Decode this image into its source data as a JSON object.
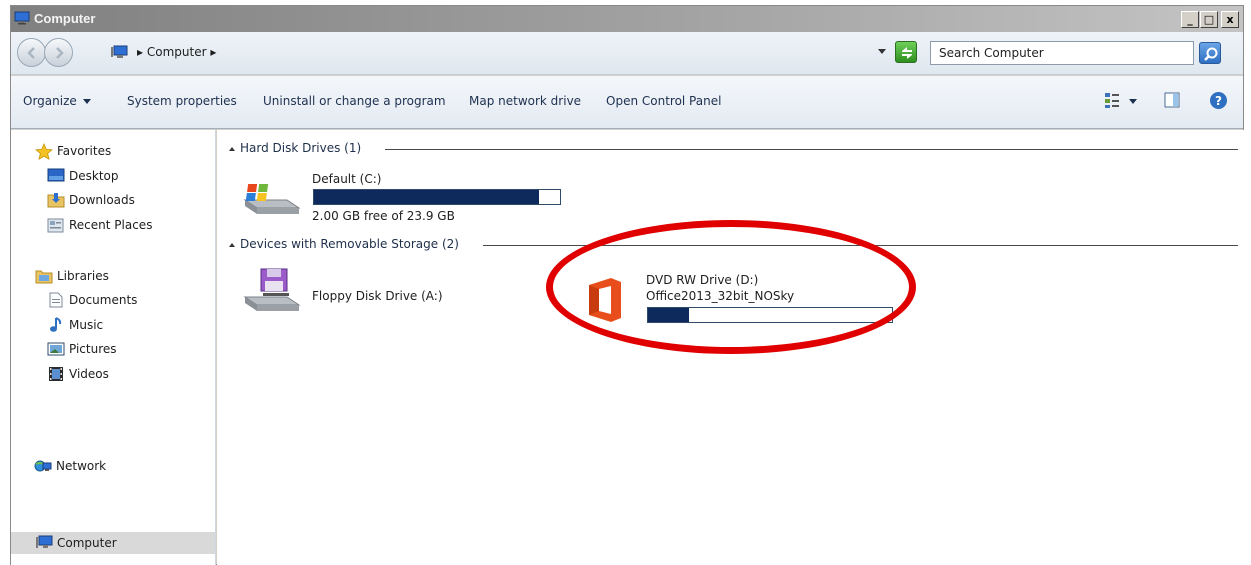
{
  "window": {
    "title": "Computer"
  },
  "caption": {
    "minimize": "_",
    "maximize": "□",
    "close": "x"
  },
  "address": {
    "path_root": "▸",
    "path_item": "Computer",
    "path_sep": "▸"
  },
  "search": {
    "placeholder": "Search Computer"
  },
  "commands": [
    {
      "label": "Organize"
    },
    {
      "label": "System properties"
    },
    {
      "label": "Uninstall or change a program"
    },
    {
      "label": "Map network drive"
    },
    {
      "label": "Open Control Panel"
    }
  ],
  "nav": {
    "favorites": "Favorites",
    "desktop": "Desktop",
    "downloads": "Downloads",
    "recent": "Recent Places",
    "libraries": "Libraries",
    "documents": "Documents",
    "music": "Music",
    "pictures": "Pictures",
    "videos": "Videos",
    "computer": "Computer",
    "network": "Network"
  },
  "groups": {
    "hdd": "Hard Disk Drives (1)",
    "removable": "Devices with Removable Storage (2)"
  },
  "drives": {
    "c": {
      "name": "Default (C:)",
      "free_text": "2.00 GB free of 23.9 GB",
      "used_fraction": 0.916
    },
    "a": {
      "name": "Floppy Disk Drive (A:)"
    },
    "d": {
      "name": "DVD RW Drive (D:)",
      "label": "Office2013_32bit_NOSky",
      "used_fraction": 0.17
    }
  },
  "colors": {
    "bar_fill": "#0e2a5c",
    "highlight_ring": "#e00000",
    "office_orange": "#e84e1b"
  }
}
